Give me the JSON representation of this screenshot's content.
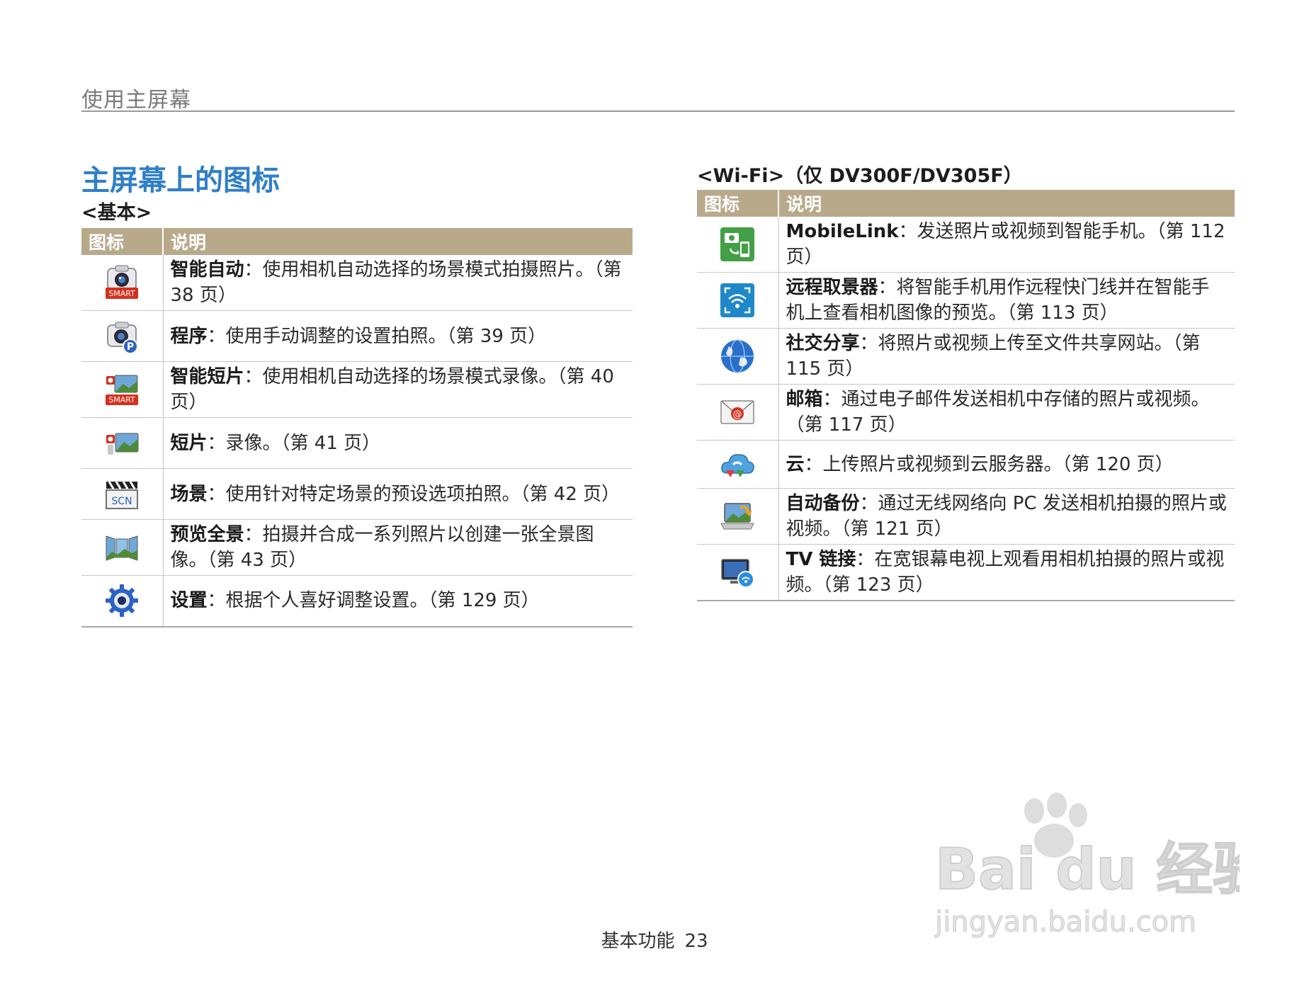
{
  "header": {
    "title": "使用主屏幕"
  },
  "section": {
    "title": "主屏幕上的图标"
  },
  "basic": {
    "subtitle": "<基本>",
    "col_icon": "图标",
    "col_desc": "说明",
    "rows": [
      {
        "icon": "smart-auto-icon",
        "term": "智能自动",
        "desc": "：使用相机自动选择的场景模式拍摄照片。（第 38 页）"
      },
      {
        "icon": "program-icon",
        "term": "程序",
        "desc": "：使用手动调整的设置拍照。（第 39 页）"
      },
      {
        "icon": "smart-movie-icon",
        "term": "智能短片",
        "desc": "：使用相机自动选择的场景模式录像。（第 40 页）"
      },
      {
        "icon": "movie-icon",
        "term": "短片",
        "desc": "：录像。（第 41 页）"
      },
      {
        "icon": "scene-icon",
        "term": "场景",
        "desc": "：使用针对特定场景的预设选项拍照。（第 42 页）"
      },
      {
        "icon": "live-panorama-icon",
        "term": "预览全景",
        "desc": "：拍摄并合成一系列照片以创建一张全景图像。（第 43 页）"
      },
      {
        "icon": "settings-icon",
        "term": "设置",
        "desc": "：根据个人喜好调整设置。（第 129 页）"
      }
    ]
  },
  "wifi": {
    "subtitle": "<Wi-Fi>（仅 DV300F/DV305F）",
    "col_icon": "图标",
    "col_desc": "说明",
    "rows": [
      {
        "icon": "mobilelink-icon",
        "term": "MobileLink",
        "desc": "：发送照片或视频到智能手机。（第 112 页）"
      },
      {
        "icon": "remote-viewfinder-icon",
        "term": "远程取景器",
        "desc": "：将智能手机用作远程快门线并在智能手机上查看相机图像的预览。（第 113 页）"
      },
      {
        "icon": "social-sharing-icon",
        "term": "社交分享",
        "desc": "：将照片或视频上传至文件共享网站。（第 115 页）"
      },
      {
        "icon": "email-icon",
        "term": "邮箱",
        "desc": "：通过电子邮件发送相机中存储的照片或视频。（第 117 页）"
      },
      {
        "icon": "cloud-icon",
        "term": "云",
        "desc": "：上传照片或视频到云服务器。（第 120 页）"
      },
      {
        "icon": "auto-backup-icon",
        "term": "自动备份",
        "desc": "：通过无线网络向 PC 发送相机拍摄的照片或视频。（第 121 页）"
      },
      {
        "icon": "tv-link-icon",
        "term": "TV 链接",
        "desc": "：在宽银幕电视上观看用相机拍摄的照片或视频。（第 123 页）"
      }
    ]
  },
  "icon_labels": {
    "smart": "SMART",
    "program": "P",
    "scene": "SCN"
  },
  "footer": {
    "section": "基本功能",
    "page": "23"
  },
  "watermark": {
    "brand": "Bai du 经验",
    "url": "jingyan.baidu.com"
  },
  "colors": {
    "accent": "#2f7fc7",
    "table_header": "#b8a98b"
  }
}
